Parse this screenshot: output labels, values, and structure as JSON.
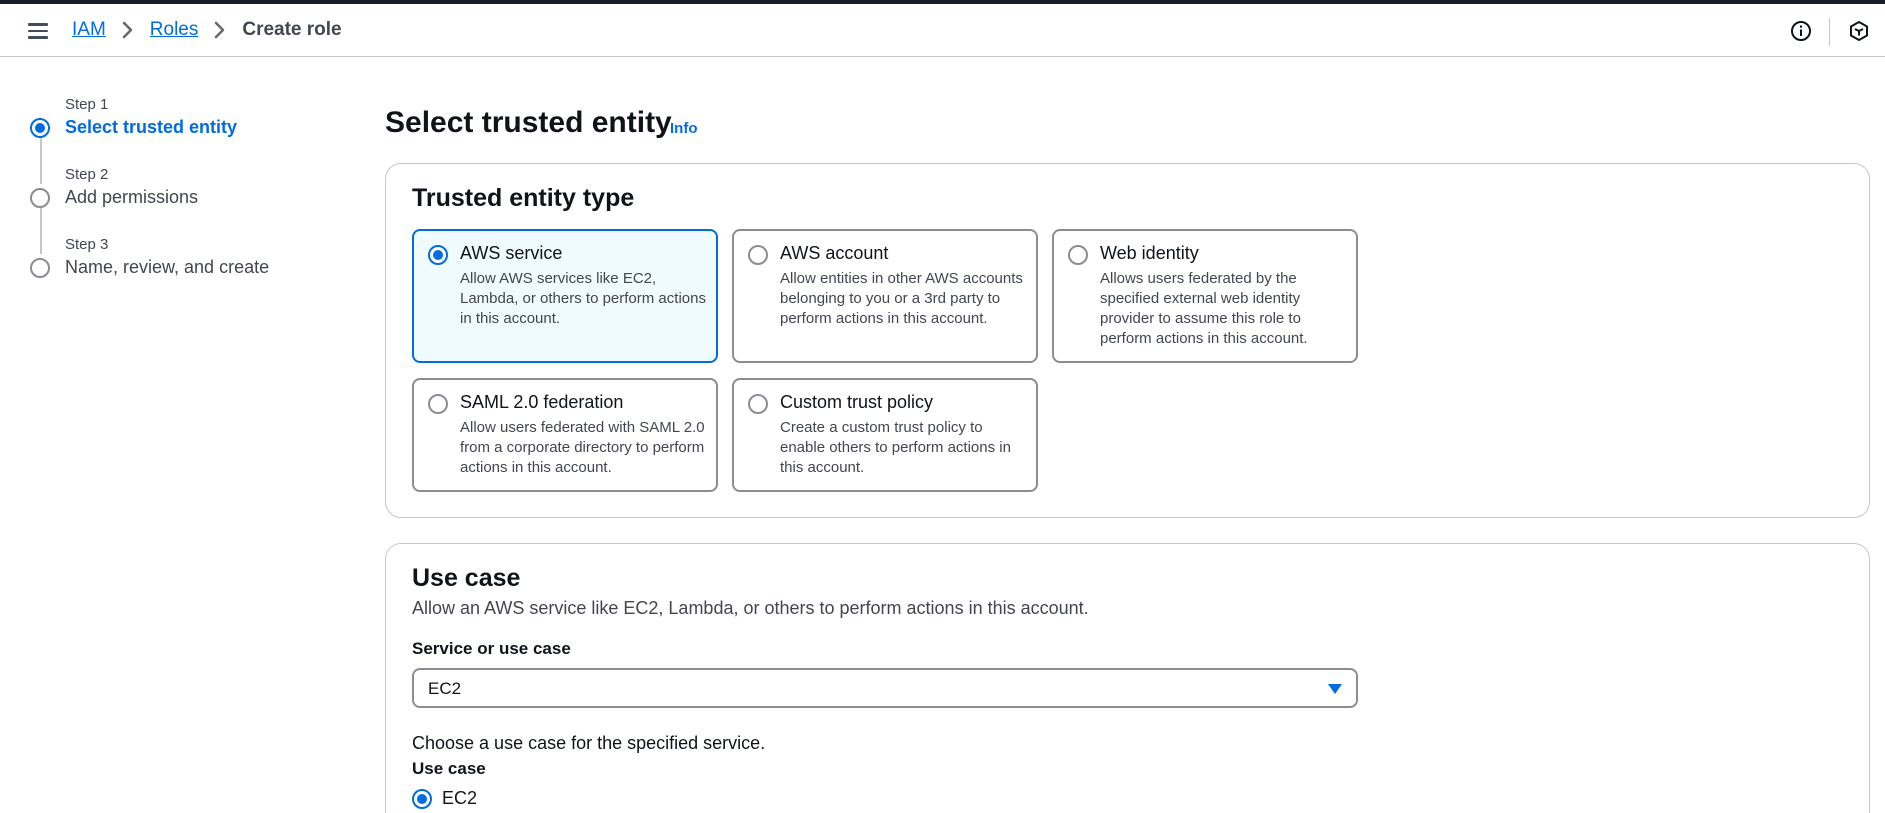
{
  "breadcrumb": {
    "items": [
      "IAM",
      "Roles"
    ],
    "current": "Create role"
  },
  "icons": {
    "menu": "menu-icon",
    "info": "info-icon",
    "cube": "cube-icon",
    "chevron": "chevron-right-icon"
  },
  "steps": [
    {
      "number": "Step 1",
      "title": "Select trusted entity",
      "state": "active"
    },
    {
      "number": "Step 2",
      "title": "Add permissions",
      "state": "inactive"
    },
    {
      "number": "Step 3",
      "title": "Name, review, and create",
      "state": "inactive"
    }
  ],
  "page": {
    "title": "Select trusted entity",
    "info_link": "Info"
  },
  "trusted_entity": {
    "title": "Trusted entity type",
    "options": [
      {
        "title": "AWS service",
        "description": "Allow AWS services like EC2, Lambda, or others to perform actions in this account.",
        "selected": true
      },
      {
        "title": "AWS account",
        "description": "Allow entities in other AWS accounts belonging to you or a 3rd party to perform actions in this account.",
        "selected": false
      },
      {
        "title": "Web identity",
        "description": "Allows users federated by the specified external web identity provider to assume this role to perform actions in this account.",
        "selected": false
      },
      {
        "title": "SAML 2.0 federation",
        "description": "Allow users federated with SAML 2.0 from a corporate directory to perform actions in this account.",
        "selected": false
      },
      {
        "title": "Custom trust policy",
        "description": "Create a custom trust policy to enable others to perform actions in this account.",
        "selected": false
      }
    ]
  },
  "use_case": {
    "title": "Use case",
    "description": "Allow an AWS service like EC2, Lambda, or others to perform actions in this account.",
    "service_label": "Service or use case",
    "service_value": "EC2",
    "choose_text": "Choose a use case for the specified service.",
    "use_case_label": "Use case",
    "selected_option": "EC2"
  },
  "colors": {
    "accent": "#006ce0",
    "selected_bg": "#f0fbff",
    "border": "#8c8c94",
    "text": "#0f141a",
    "secondary_text": "#424650"
  }
}
